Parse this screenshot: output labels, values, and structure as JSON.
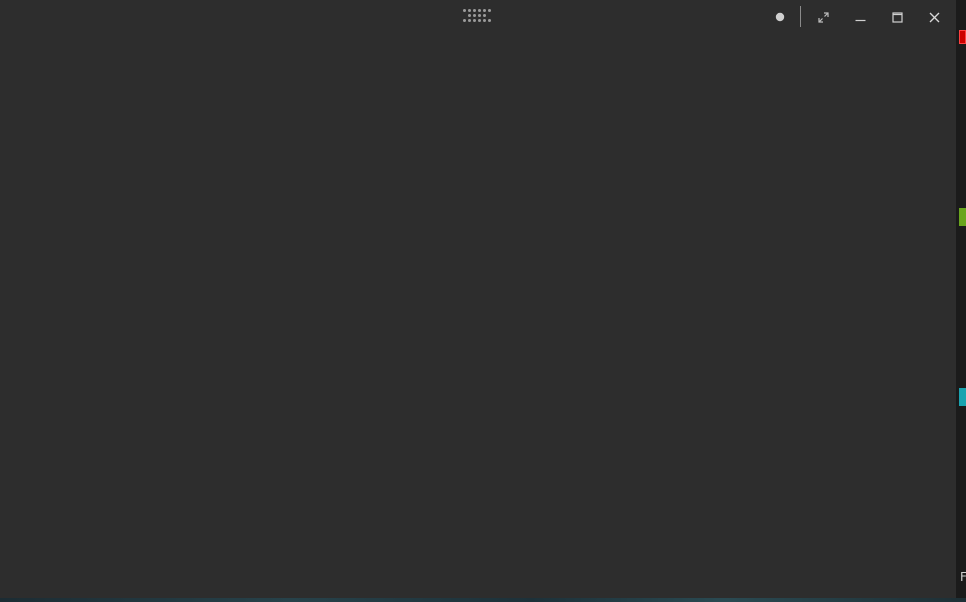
{
  "window": {
    "background": "#2d2d2d",
    "titlebar": {
      "drag_handle_icon": "drag-grip-icon",
      "controls": [
        {
          "name": "record-button",
          "icon": "dot-icon"
        },
        {
          "name": "exit-fullscreen-button",
          "icon": "collapse-arrows-icon"
        },
        {
          "name": "minimize-button",
          "icon": "minimize-icon"
        },
        {
          "name": "maximize-button",
          "icon": "maximize-icon"
        },
        {
          "name": "close-button",
          "icon": "close-icon"
        }
      ]
    }
  },
  "right_strip": {
    "marks": [
      {
        "color": "#cc0000"
      },
      {
        "color": "#6aa51e"
      },
      {
        "color": "#1aa3b0"
      }
    ],
    "text": "F"
  }
}
